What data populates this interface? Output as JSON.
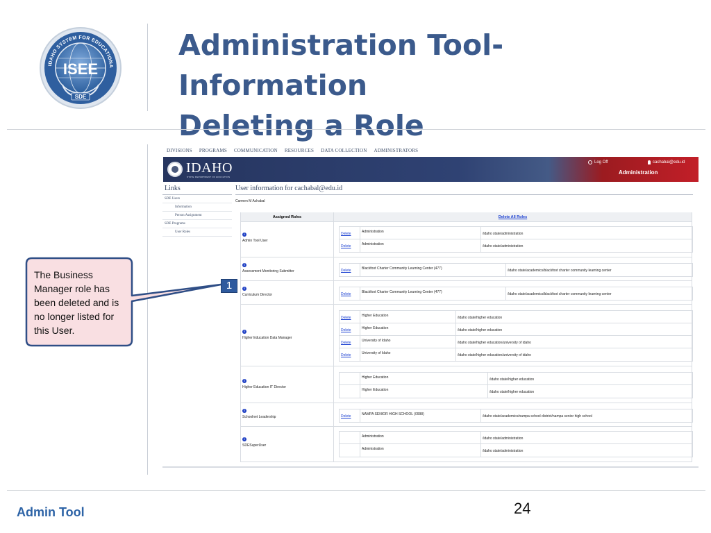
{
  "slide": {
    "title_line1": "Administration Tool- Information",
    "title_line2": "Deleting a Role",
    "footer": "Admin Tool",
    "page_number": "24",
    "logo": {
      "center_text": "ISEE",
      "ring_text": "IDAHO SYSTEM FOR EDUCATIONAL EXCELLENCE",
      "bottom_text": "SDE"
    }
  },
  "topnav": [
    "DIVISIONS",
    "PROGRAMS",
    "COMMUNICATION",
    "RESOURCES",
    "DATA COLLECTION",
    "ADMINISTRATORS"
  ],
  "banner": {
    "name": "IDAHO",
    "subtitle": "STATE DEPARTMENT OF EDUCATION",
    "logoff": "Log Off",
    "user_email": "cachabal@edu.id",
    "section": "Administration"
  },
  "sidebar": {
    "title": "Links",
    "items": [
      {
        "label": "SDE Users",
        "level": 1
      },
      {
        "label": "Information",
        "level": 2
      },
      {
        "label": "Person Assignment",
        "level": 2
      },
      {
        "label": "SDE Programs",
        "level": 1
      },
      {
        "label": "User Roles",
        "level": 2
      }
    ]
  },
  "content": {
    "title": "User information for cachabal@edu.id",
    "full_name": "Carmen M Achabal",
    "assigned_roles_header": "Assigned Roles",
    "delete_all_label": "Delete All Roles",
    "delete_label": "Delete",
    "info_glyph": "i"
  },
  "roles": [
    {
      "name": "Admin Tool User",
      "rows": [
        {
          "delete": "Delete",
          "org": "Administration",
          "path": "/idaho state/administration"
        },
        {
          "delete": "Delete",
          "org": "Administration",
          "path": "/idaho state/administration"
        }
      ]
    },
    {
      "name": "Assessment Monitoring Submitter",
      "rows": [
        {
          "delete": "Delete",
          "org": "Blackfoot Charter Community Learning Center (477)",
          "path": "/idaho state/academics/blackfoot charter community learning center"
        }
      ]
    },
    {
      "name": "Curriculum Director",
      "rows": [
        {
          "delete": "Delete",
          "org": "Blackfoot Charter Community Learning Center (477)",
          "path": "/idaho state/academics/blackfoot charter community learning center"
        }
      ]
    },
    {
      "name": "Higher Education Data Manager",
      "rows": [
        {
          "delete": "Delete",
          "org": "Higher Education",
          "path": "/idaho state/higher education"
        },
        {
          "delete": "Delete",
          "org": "Higher Education",
          "path": "/idaho state/higher education"
        },
        {
          "delete": "Delete",
          "org": "University of Idaho",
          "path": "/idaho state/higher education/university of idaho"
        },
        {
          "delete": "Delete",
          "org": "University of Idaho",
          "path": "/idaho state/higher education/university of idaho"
        }
      ]
    },
    {
      "name": "Higher Education IT Director",
      "rows": [
        {
          "delete": "",
          "org": "Higher Education",
          "path": "/idaho state/higher education"
        },
        {
          "delete": "",
          "org": "Higher Education",
          "path": "/idaho state/higher education"
        }
      ]
    },
    {
      "name": "Schoolnet Leadership",
      "rows": [
        {
          "delete": "Delete",
          "org": "NAMPA SENIOR HIGH SCHOOL (0998)",
          "path": "/idaho state/academics/nampa school district/nampa senior high school"
        }
      ]
    },
    {
      "name": "SDESuperUser",
      "rows": [
        {
          "delete": "",
          "org": "Administration",
          "path": "/idaho state/administration"
        },
        {
          "delete": "",
          "org": "Administration",
          "path": "/idaho state/administration"
        }
      ]
    }
  ],
  "callout": {
    "text": "The Business Manager role has been deleted and is no longer listed for this User.",
    "badge": "1"
  },
  "colors": {
    "title_blue": "#3b5a8c",
    "footer_blue": "#2d63a6",
    "banner_navy": "#26355f",
    "banner_red": "#c21f28",
    "link_blue": "#1a3fd1",
    "callout_fill": "#f9dfe2",
    "callout_border": "#2f4e86"
  }
}
